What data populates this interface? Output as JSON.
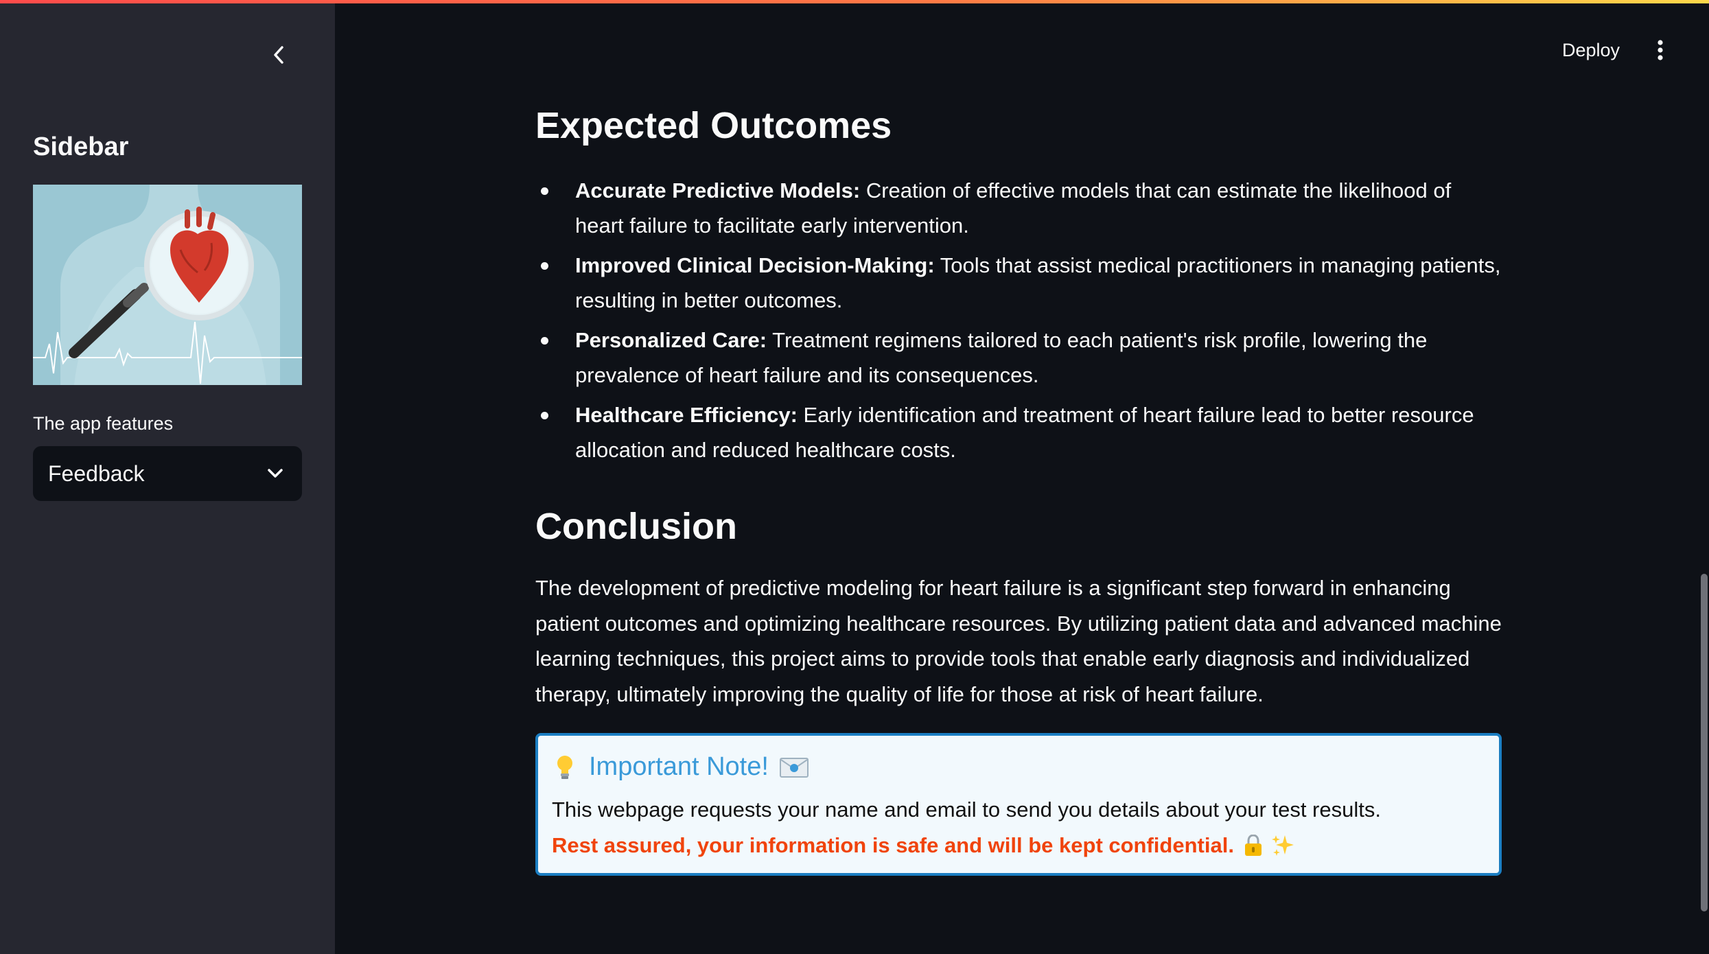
{
  "sidebar": {
    "collapse_icon": "chevron-left-icon",
    "title": "Sidebar",
    "image_icon": "heart-magnifier-illustration",
    "select_label": "The app features",
    "select_value": "Feedback",
    "select_icon": "chevron-down-icon"
  },
  "header": {
    "deploy_label": "Deploy",
    "menu_icon": "vertical-dots-icon"
  },
  "main": {
    "outcomes_heading": "Expected Outcomes",
    "outcomes": [
      {
        "title": "Accurate Predictive Models:",
        "text": " Creation of effective models that can estimate the likelihood of heart failure to facilitate early intervention."
      },
      {
        "title": "Improved Clinical Decision-Making:",
        "text": " Tools that assist medical practitioners in managing patients, resulting in better outcomes."
      },
      {
        "title": "Personalized Care:",
        "text": " Treatment regimens tailored to each patient's risk profile, lowering the prevalence of heart failure and its consequences."
      },
      {
        "title": "Healthcare Efficiency:",
        "text": " Early identification and treatment of heart failure lead to better resource allocation and reduced healthcare costs."
      }
    ],
    "conclusion_heading": "Conclusion",
    "conclusion_text": "The development of predictive modeling for heart failure is a significant step forward in enhancing patient outcomes and optimizing healthcare resources. By utilizing patient data and advanced machine learning techniques, this project aims to provide tools that enable early diagnosis and individualized therapy, ultimately improving the quality of life for those at risk of heart failure.",
    "note": {
      "title": "Important Note!",
      "line1": "This webpage requests your name and email to send you details about your test results.",
      "line2": "Rest assured, your information is safe and will be kept confidential.",
      "icons": [
        "lightbulb-icon",
        "envelope-icon",
        "lock-icon",
        "sparkles-icon"
      ]
    }
  },
  "colors": {
    "app_background": "#0e1117",
    "sidebar_background": "#262730",
    "text": "#fafafa",
    "note_background": "#f2f9fd",
    "note_border": "#1b7ec2",
    "note_title": "#3a9ad9",
    "note_warning": "#f0440c"
  }
}
